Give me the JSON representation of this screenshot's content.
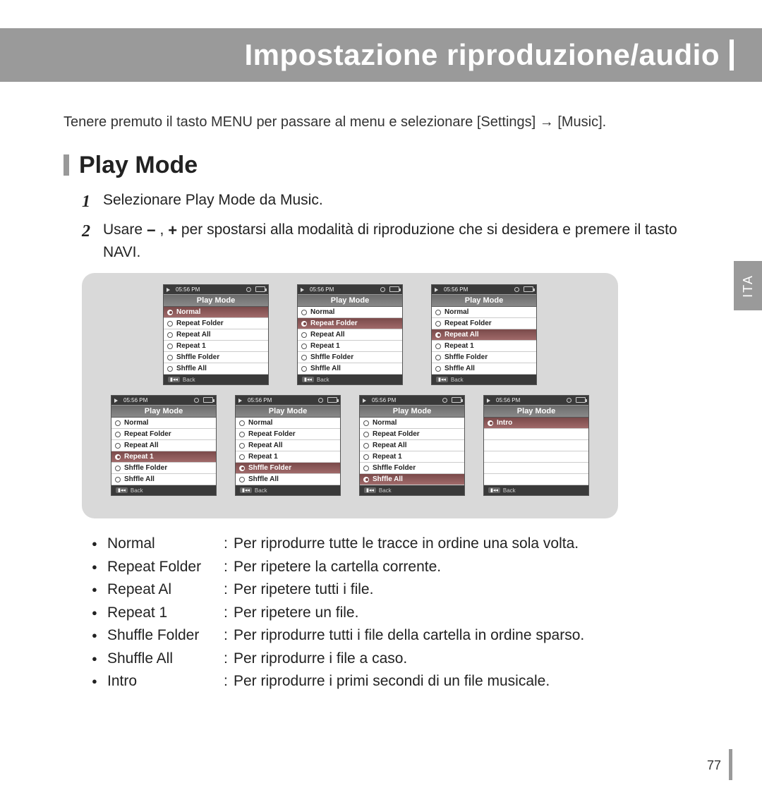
{
  "header": {
    "title": "Impostazione riproduzione/audio"
  },
  "intro": "Tenere premuto il tasto MENU per passare al menu e selezionare [Settings] → [Music].",
  "section": {
    "title": "Play Mode"
  },
  "side_tab": "ITA",
  "steps": {
    "s1_num": "1",
    "s1": "Selezionare Play Mode da Music.",
    "s2_num": "2",
    "s2a": "Usare ",
    "s2b": " , ",
    "s2c": "  per spostarsi alla modalità di riproduzione che si desidera e premere il tasto NAVI.",
    "minus": "−",
    "plus": "+"
  },
  "screen": {
    "time": "05:56 PM",
    "title": "Play Mode",
    "back": "Back",
    "back_icon": "▮◂◂",
    "items": [
      "Normal",
      "Repeat Folder",
      "Repeat All",
      "Repeat 1",
      "Shffle Folder",
      "Shffle All"
    ],
    "intro_item": "Intro"
  },
  "row1_sel": [
    0,
    1,
    2
  ],
  "row2_sel": [
    3,
    4,
    5
  ],
  "desc": [
    {
      "term": "Normal",
      "def": "Per riprodurre tutte le tracce in ordine una sola volta."
    },
    {
      "term": "Repeat Folder",
      "def": "Per ripetere la cartella corrente."
    },
    {
      "term": "Repeat Al",
      "def": "Per ripetere tutti i file."
    },
    {
      "term": "Repeat 1",
      "def": "Per ripetere un file."
    },
    {
      "term": "Shuffle Folder",
      "def": "Per riprodurre tutti i file della cartella in ordine sparso."
    },
    {
      "term": "Shuffle All",
      "def": "Per riprodurre i file a caso."
    },
    {
      "term": "Intro",
      "def": "Per riprodurre i primi secondi di un file musicale."
    }
  ],
  "page_num": "77"
}
